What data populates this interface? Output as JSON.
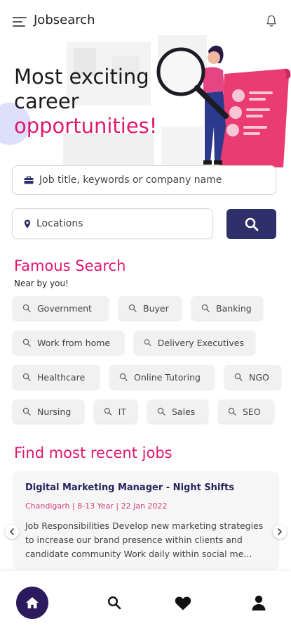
{
  "app": {
    "title": "Jobsearch"
  },
  "icons": {
    "menu": "menu-icon",
    "notifications": "bell-icon",
    "keyword": "briefcase-icon",
    "location": "location-pin-icon",
    "search": "search-icon",
    "chip": "search-icon",
    "home": "home-icon",
    "favorites": "heart-icon",
    "profile": "user-icon"
  },
  "colors": {
    "accent": "#e0186f",
    "primary": "#2f2f6a",
    "nav_active": "#2b1a5e"
  },
  "hero": {
    "line1": "Most exciting",
    "line2": "career",
    "line3": "opportunities!"
  },
  "search": {
    "keyword_placeholder": "Job title, keywords or company name",
    "location_placeholder": "Locations"
  },
  "famous": {
    "title": "Famous Search",
    "subtitle": "Near by you!",
    "rows": [
      [
        "Government",
        "Buyer",
        "Banking"
      ],
      [
        "Work from home",
        "Delivery Executives"
      ],
      [
        "Healthcare",
        "Online Tutoring",
        "NGO"
      ],
      [
        "Nursing",
        "IT",
        "Sales",
        "SEO"
      ]
    ]
  },
  "recent": {
    "title": "Find most recent jobs",
    "job": {
      "title": "Digital Marketing Manager - Night Shifts",
      "meta": "Chandigarh | 8-13 Year | 22 Jan 2022",
      "description": "Job Responsibilities Develop new marketing strategies to increase our brand presence within clients and candidate community Work daily within social me..."
    }
  }
}
